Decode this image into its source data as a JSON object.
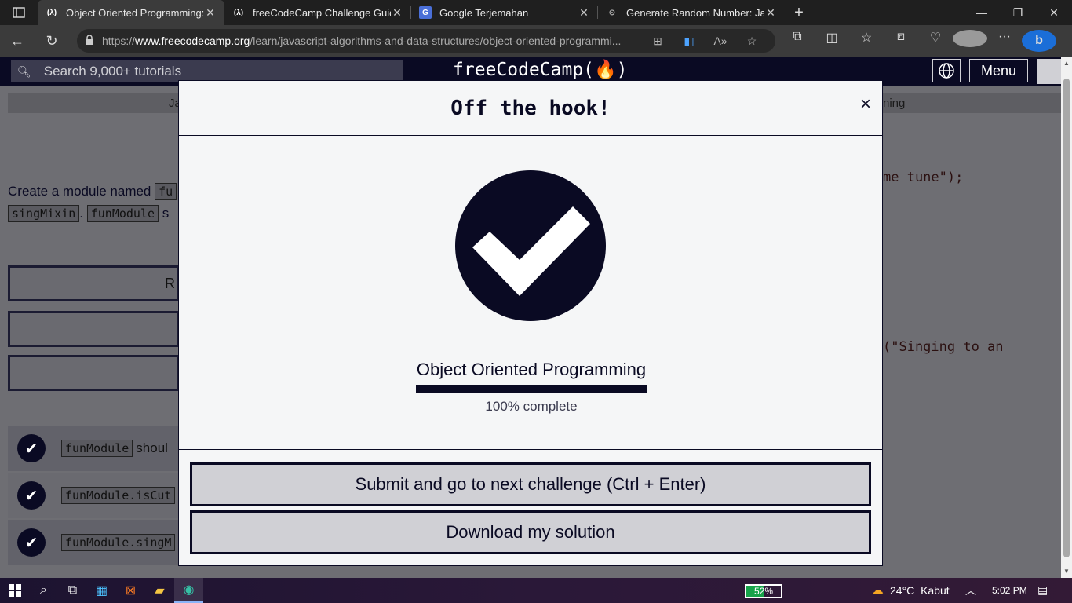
{
  "browser": {
    "tabs": [
      {
        "favicon": "(λ)",
        "title": "Object Oriented Programming: U",
        "active": true
      },
      {
        "favicon": "(λ)",
        "title": "freeCodeCamp Challenge Guide",
        "active": false
      },
      {
        "favicon": "G",
        "title": "Google Terjemahan",
        "active": false
      },
      {
        "favicon": "⊙",
        "title": "Generate Random Number: Java",
        "active": false
      }
    ],
    "url_prefix": "https://",
    "url_domain": "www.freecodecamp.org",
    "url_path": "/learn/javascript-algorithms-and-data-structures/object-oriented-programmi..."
  },
  "fcc_nav": {
    "search_placeholder": "Search 9,000+ tutorials",
    "brand": "freeCodeCamp(🔥)",
    "menu_label": "Menu"
  },
  "background": {
    "tab_left": "Ja",
    "tab_right": "ning",
    "description_prefix": "Create a module named",
    "description_code1": "fu",
    "description_line2_code1": "singMixin",
    "description_line2_sep": ".",
    "description_line2_code2": "funModule",
    "description_line2_suffix": "s",
    "run_button_partial": "R",
    "tests": [
      {
        "code": "funModule",
        "text": "shoul"
      },
      {
        "code": "funModule.isCut",
        "text": ""
      },
      {
        "code": "funModule.singM",
        "text": ""
      }
    ],
    "code_line1": "me tune\");",
    "code_line2": "(\"Singing to an"
  },
  "modal": {
    "title": "Off the hook!",
    "close_symbol": "×",
    "certification": "Object Oriented Programming",
    "progress_fraction": 1.0,
    "progress_text": "100% complete",
    "submit_label": "Submit and go to next challenge (Ctrl + Enter)",
    "download_label": "Download my solution"
  },
  "taskbar": {
    "battery": "52%",
    "battery_fraction": 0.52,
    "temperature": "24°C",
    "weather": "Kabut",
    "time": "5:02 PM"
  }
}
